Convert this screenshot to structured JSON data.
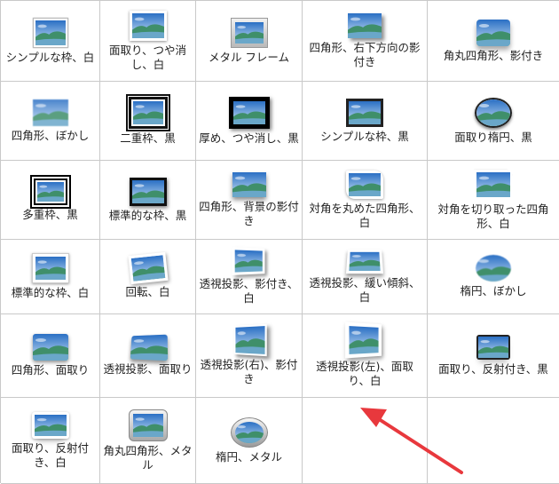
{
  "gallery": {
    "styles": [
      {
        "label": "シンプルな枠、白"
      },
      {
        "label": "面取り、つや消し、白"
      },
      {
        "label": "メタル フレーム"
      },
      {
        "label": "四角形、右下方向の影付き"
      },
      {
        "label": "角丸四角形、影付き"
      },
      {
        "label": "四角形、ぼかし"
      },
      {
        "label": "二重枠、黒"
      },
      {
        "label": "厚め、つや消し、黒"
      },
      {
        "label": "シンプルな枠、黒"
      },
      {
        "label": "面取り楕円、黒"
      },
      {
        "label": "多重枠、黒"
      },
      {
        "label": "標準的な枠、黒"
      },
      {
        "label": "四角形、背景の影付き"
      },
      {
        "label": "対角を丸めた四角形、白"
      },
      {
        "label": "対角を切り取った四角形、白"
      },
      {
        "label": "標準的な枠、白"
      },
      {
        "label": "回転、白"
      },
      {
        "label": "透視投影、影付き、白"
      },
      {
        "label": "透視投影、緩い傾斜、白"
      },
      {
        "label": "楕円、ぼかし"
      },
      {
        "label": "四角形、面取り"
      },
      {
        "label": "透視投影、面取り"
      },
      {
        "label": "透視投影(右)、影付き"
      },
      {
        "label": "透視投影(左)、面取り、白"
      },
      {
        "label": "面取り、反射付き、黒"
      },
      {
        "label": "面取り、反射付き、白"
      },
      {
        "label": "角丸四角形、メタル"
      },
      {
        "label": "楕円、メタル"
      }
    ]
  },
  "colors": {
    "grid_line": "#c9c9c9",
    "arrow": "#e8383d",
    "sky_top": "#2a6fc4",
    "sky_bottom": "#cfe6f7",
    "hill": "#3f8f6a",
    "water": "#6aa7c9"
  },
  "icons": {
    "thumbnail": "landscape-thumbnail-icon",
    "pointer": "red-arrow-annotation"
  }
}
